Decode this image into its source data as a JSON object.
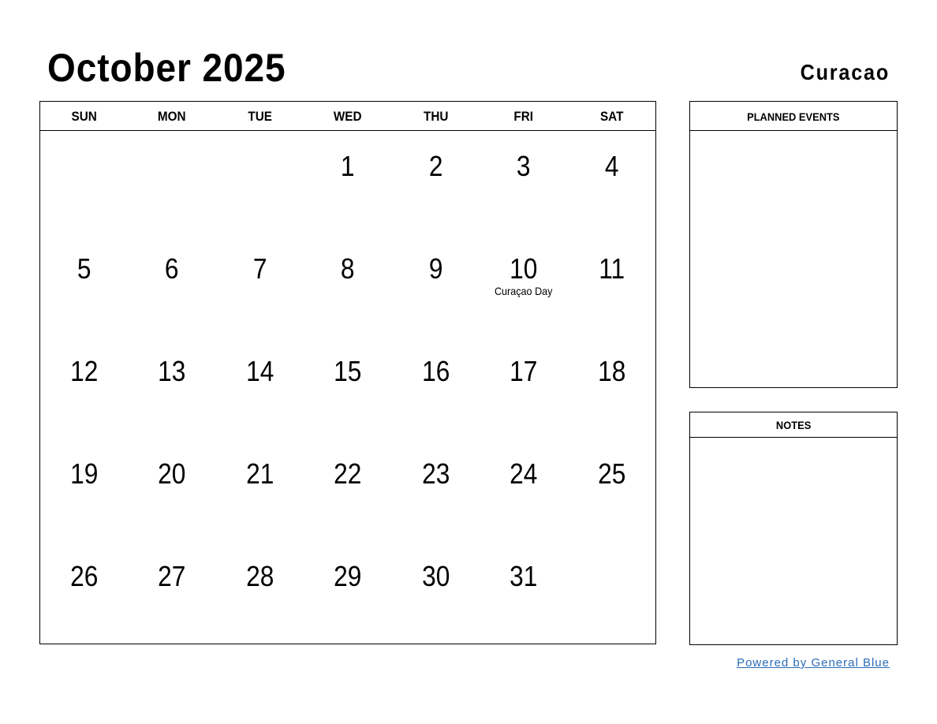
{
  "header": {
    "title": "October 2025",
    "country": "Curacao"
  },
  "calendar": {
    "weekdays": [
      "SUN",
      "MON",
      "TUE",
      "WED",
      "THU",
      "FRI",
      "SAT"
    ],
    "weeks": [
      [
        {
          "day": ""
        },
        {
          "day": ""
        },
        {
          "day": ""
        },
        {
          "day": "1"
        },
        {
          "day": "2"
        },
        {
          "day": "3"
        },
        {
          "day": "4"
        }
      ],
      [
        {
          "day": "5"
        },
        {
          "day": "6"
        },
        {
          "day": "7"
        },
        {
          "day": "8"
        },
        {
          "day": "9"
        },
        {
          "day": "10",
          "holiday": "Curaçao Day"
        },
        {
          "day": "11"
        }
      ],
      [
        {
          "day": "12"
        },
        {
          "day": "13"
        },
        {
          "day": "14"
        },
        {
          "day": "15"
        },
        {
          "day": "16"
        },
        {
          "day": "17"
        },
        {
          "day": "18"
        }
      ],
      [
        {
          "day": "19"
        },
        {
          "day": "20"
        },
        {
          "day": "21"
        },
        {
          "day": "22"
        },
        {
          "day": "23"
        },
        {
          "day": "24"
        },
        {
          "day": "25"
        }
      ],
      [
        {
          "day": "26"
        },
        {
          "day": "27"
        },
        {
          "day": "28"
        },
        {
          "day": "29"
        },
        {
          "day": "30"
        },
        {
          "day": "31"
        },
        {
          "day": ""
        }
      ]
    ]
  },
  "panels": {
    "planned_events": "PLANNED EVENTS",
    "notes": "NOTES"
  },
  "footer": {
    "link_text": "Powered by General Blue",
    "link_color": "#2b6cb8"
  }
}
